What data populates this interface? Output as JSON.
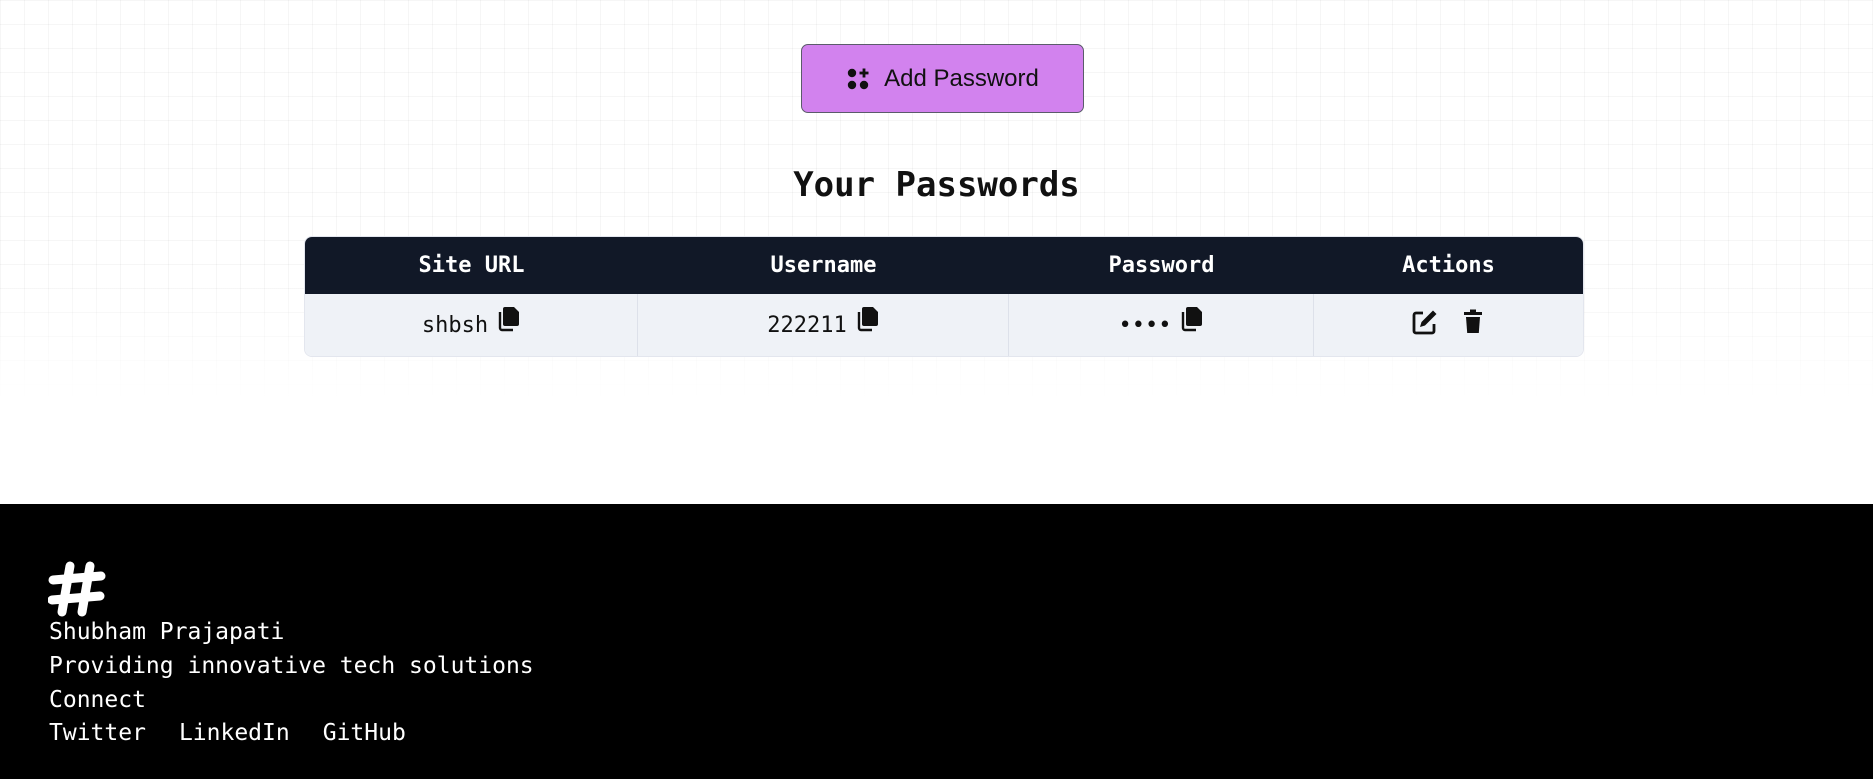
{
  "add_button": {
    "label": "Add Password",
    "icon": "add-password-icon"
  },
  "section_title": "Your Passwords",
  "table": {
    "headers": [
      "Site URL",
      "Username",
      "Password",
      "Actions"
    ],
    "rows": [
      {
        "site": "shbsh",
        "username": "222211",
        "password": "••••"
      }
    ]
  },
  "footer": {
    "logo_icon": "hash-logo-icon",
    "name": "Shubham Prajapati",
    "tagline": "Providing innovative tech solutions",
    "connect": "Connect",
    "links": [
      "Twitter",
      "LinkedIn",
      "GitHub"
    ]
  },
  "colors": {
    "button_bg": "#d282ee",
    "table_header_bg": "#111827",
    "table_row_bg": "#eff2f7",
    "footer_bg": "#000000"
  }
}
